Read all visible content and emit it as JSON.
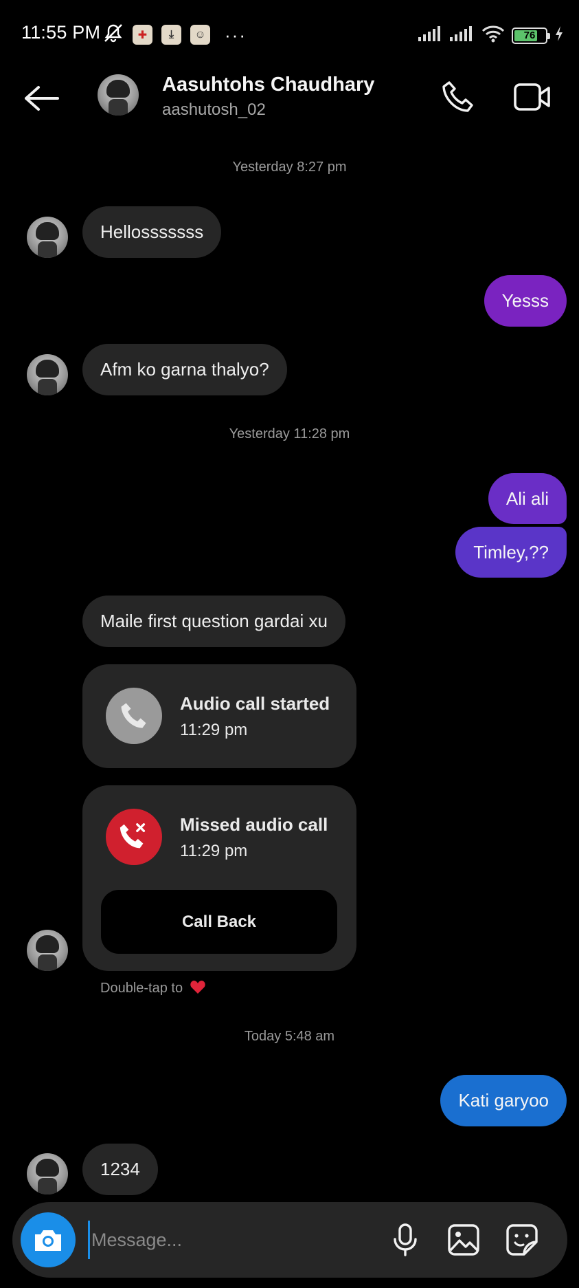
{
  "status_bar": {
    "time": "11:55 PM",
    "battery": "76",
    "more": "···"
  },
  "header": {
    "name": "Aasuhtohs Chaudhary",
    "username": "aashutosh_02"
  },
  "timestamps": {
    "t1": "Yesterday 8:27 pm",
    "t2": "Yesterday 11:28 pm",
    "t3": "Today 5:48 am"
  },
  "messages": [
    {
      "text": "Hellosssssss",
      "from": "them"
    },
    {
      "text": "Yesss",
      "from": "me"
    },
    {
      "text": "Afm ko garna thalyo?",
      "from": "them"
    },
    {
      "text": "Ali ali",
      "from": "me"
    },
    {
      "text": "Timley,??",
      "from": "me"
    },
    {
      "text": "Maile first question gardai xu",
      "from": "them"
    },
    {
      "text": "Kati garyoo",
      "from": "me"
    },
    {
      "text": "1234",
      "from": "them"
    }
  ],
  "calls": {
    "started": {
      "title": "Audio call started",
      "time": "11:29 pm"
    },
    "missed": {
      "title": "Missed audio call",
      "time": "11:29 pm",
      "action": "Call Back"
    }
  },
  "hint": "Double-tap to",
  "composer": {
    "placeholder": "Message..."
  },
  "colors": {
    "purple_bubble_1": "#7a23c0",
    "purple_bubble_2": "#5a35c8",
    "blue_bubble": "#1a6fd0",
    "missed_red": "#d0202e",
    "camera_blue": "#1a8ee8"
  }
}
